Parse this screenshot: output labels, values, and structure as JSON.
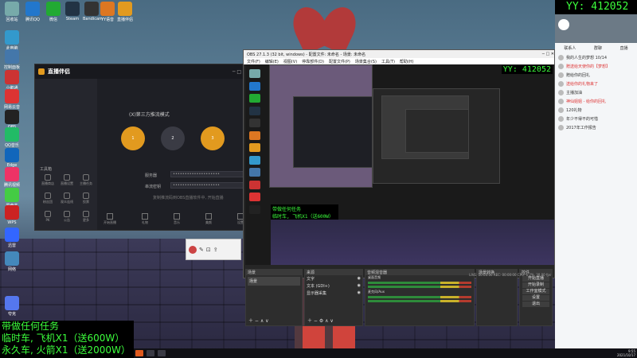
{
  "overlays": {
    "yy_id": "YY: 412052",
    "lines": [
      "带做任何任务",
      "临时车, 飞机X1（送600W）",
      "永久车, 火箭X1（送2000W）"
    ]
  },
  "obs": {
    "title": "OBS 27.1.3 (32 bit, windows) - 配置文件: 未命名 - 场景: 未命名",
    "menu": [
      "文件(F)",
      "编辑(E)",
      "视图(V)",
      "停靠部件(D)",
      "配置文件(P)",
      "场景集合(S)",
      "工具(T)",
      "帮助(H)"
    ],
    "docks": {
      "scenes": "场景",
      "sources": "来源",
      "mixer": "音频混音器",
      "transitions": "场景转换",
      "controls": "控件"
    },
    "scene_item": "场景",
    "sources": [
      "文字",
      "文本 (GDI+)",
      "显示器采集"
    ],
    "mixer_channels": [
      "桌面音频",
      "麦克风/Aux"
    ],
    "controls": [
      "开始直播",
      "开始录制",
      "工作室模式",
      "设置",
      "退出"
    ],
    "status": "LIVE: 00:00:00  REC: 00:00:00  CPU: 6.2%, 30.00 fps"
  },
  "zhibo": {
    "logo": "直播伴侣",
    "mode_title": "(X)第三方推流模式",
    "steps": [
      "推流地址",
      "推流码"
    ],
    "server_label": "服务器",
    "key_label": "串流密钥",
    "server_value": "••••••••••••••••••••",
    "key_value": "••••••••••••••••••••",
    "hint": "复制推流码到OBS直播软件中, 开始直播",
    "tools_title": "工具箱",
    "tools": [
      "直播商店",
      "直播设置",
      "主播任务",
      "粉丝团",
      "观众连线",
      "投票",
      "PK",
      "公告",
      "更多"
    ],
    "bottom": [
      "开始直播",
      "礼物",
      "音乐",
      "美颜",
      "设置"
    ]
  },
  "yy_panel": {
    "tabs": [
      "联系人",
      "群聊",
      "直播"
    ],
    "items": [
      {
        "t": "我的人生的梦想  10/14",
        "red": false
      },
      {
        "t": "赠送给天使你的【梦想】",
        "red": true
      },
      {
        "t": "赠给你的回礼",
        "red": false
      },
      {
        "t": "送给你的礼物来了",
        "red": true
      },
      {
        "t": "主播加油",
        "red": false
      },
      {
        "t": "神仙姐姐 - 给你的回礼",
        "red": true
      },
      {
        "t": "120礼物",
        "red": false
      },
      {
        "t": "年少不得不的可惜",
        "red": false
      },
      {
        "t": "2017年工作报告",
        "red": false
      }
    ]
  },
  "desktop_icons": [
    "回收站",
    "腾讯QQ",
    "微信",
    "Steam",
    "Bandicam",
    "YY语音",
    "直播伴侣",
    "此电脑",
    "控制面板",
    "小鹅通",
    "网易云音乐",
    "OBS Studio",
    "QQ音乐",
    "Edge",
    "腾讯视频",
    "爱奇艺",
    "WPS",
    "迅雷",
    "网络",
    "夸克"
  ],
  "clock": {
    "time": "9:55",
    "date": "2021/10/17"
  }
}
